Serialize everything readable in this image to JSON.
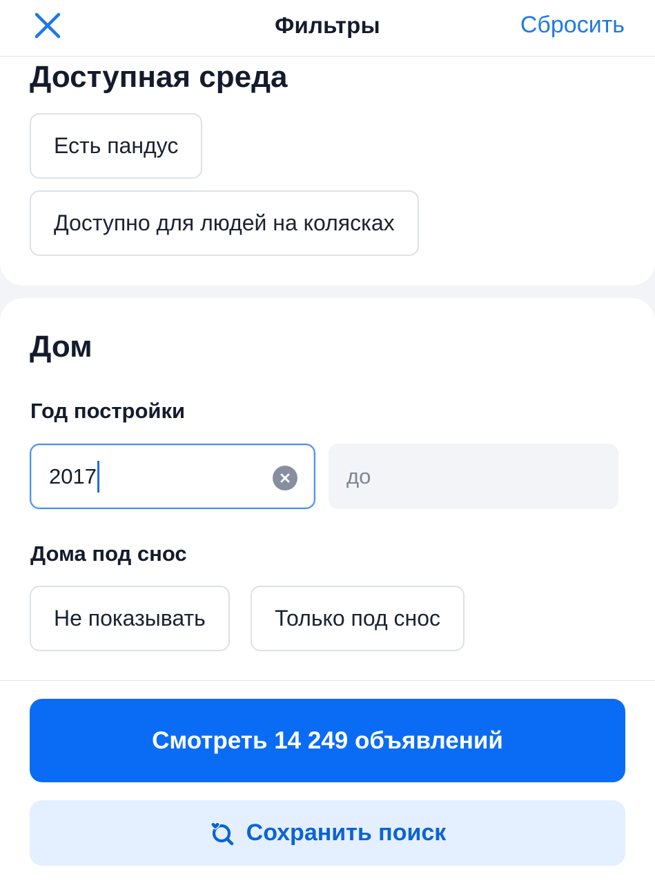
{
  "header": {
    "title": "Фильтры",
    "reset_label": "Сбросить"
  },
  "accessibility": {
    "title": "Доступная среда",
    "options": [
      "Есть пандус",
      "Доступно для людей на колясках"
    ]
  },
  "house": {
    "title": "Дом",
    "year": {
      "label": "Год постройки",
      "from_value": "2017",
      "to_placeholder": "до"
    },
    "demolition": {
      "label": "Дома под снос",
      "options": [
        "Не показывать",
        "Только под снос"
      ]
    }
  },
  "actions": {
    "show_label": "Смотреть 14 249 объявлений",
    "save_label": "Сохранить поиск"
  },
  "colors": {
    "accent": "#0a6cf5",
    "link": "#1f7ae0",
    "secondary_bg": "#e4efff"
  }
}
